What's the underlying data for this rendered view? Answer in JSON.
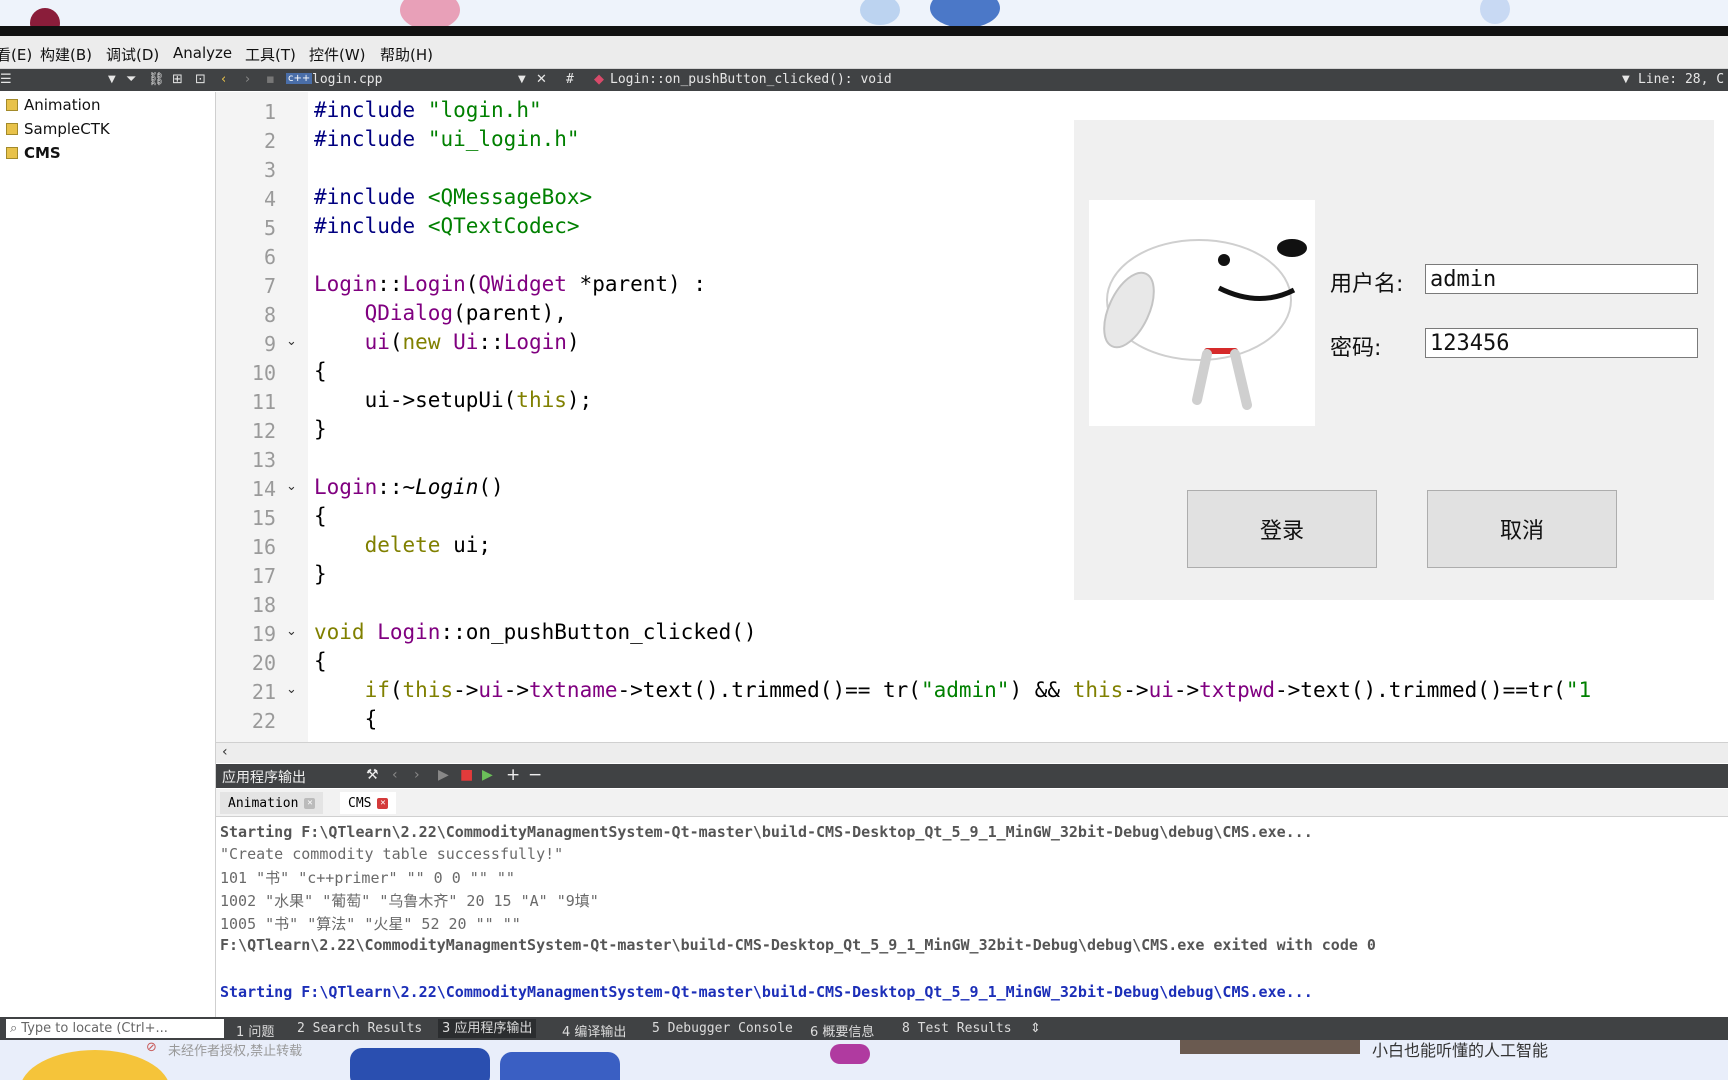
{
  "menubar": {
    "items": [
      "看(E)",
      "构建(B)",
      "调试(D)",
      "Analyze",
      "工具(T)",
      "控件(W)",
      "帮助(H)"
    ]
  },
  "toolbar": {
    "file_name": "login.cpp",
    "hash": "#",
    "function_signature": "Login::on_pushButton_clicked(): void",
    "line_info": "Line: 28, C"
  },
  "sidebar": {
    "projects": [
      "Animation",
      "SampleCTK",
      "CMS"
    ]
  },
  "editor": {
    "line_numbers": [
      "1",
      "2",
      "3",
      "4",
      "5",
      "6",
      "7",
      "8",
      "9",
      "10",
      "11",
      "12",
      "13",
      "14",
      "15",
      "16",
      "17",
      "18",
      "19",
      "20",
      "21",
      "22"
    ]
  },
  "dialog": {
    "username_label": "用户名:",
    "username_value": "admin",
    "password_label": "密码:",
    "password_value": "123456",
    "login_button": "登录",
    "cancel_button": "取消"
  },
  "output_pane": {
    "title": "应用程序输出",
    "tabs": [
      "Animation",
      "CMS"
    ],
    "lines": [
      "Starting F:\\QTlearn\\2.22\\CommodityManagmentSystem-Qt-master\\build-CMS-Desktop_Qt_5_9_1_MinGW_32bit-Debug\\debug\\CMS.exe...",
      "\"Create commodity table successfully!\"",
      "101 \"书\" \"c++primer\" \"\" 0 0 \"\" \"\"",
      "1002 \"水果\" \"葡萄\" \"乌鲁木齐\" 20 15 \"A\" \"9填\"",
      "1005 \"书\" \"算法\" \"火星\" 52 20 \"\" \"\"",
      "F:\\QTlearn\\2.22\\CommodityManagmentSystem-Qt-master\\build-CMS-Desktop_Qt_5_9_1_MinGW_32bit-Debug\\debug\\CMS.exe exited with code 0",
      "Starting F:\\QTlearn\\2.22\\CommodityManagmentSystem-Qt-master\\build-CMS-Desktop_Qt_5_9_1_MinGW_32bit-Debug\\debug\\CMS.exe..."
    ]
  },
  "statusbar": {
    "locator_placeholder": "Type to locate (Ctrl+...",
    "tabs": [
      "1 问题",
      "2 Search Results",
      "3 应用程序输出",
      "4 编译输出",
      "5 Debugger Console",
      "6 概要信息",
      "8 Test Results"
    ]
  },
  "overlay": {
    "watermark": "未经作者授权,禁止转载",
    "bottom_caption": "小白也能听懂的人工智能"
  },
  "colors": {
    "toolbar_bg": "#404244",
    "dialog_bg": "#f0f0f0",
    "string_green": "#008000",
    "keyword_olive": "#808000",
    "class_purple": "#800080",
    "output_blue": "#1c2fb8"
  }
}
